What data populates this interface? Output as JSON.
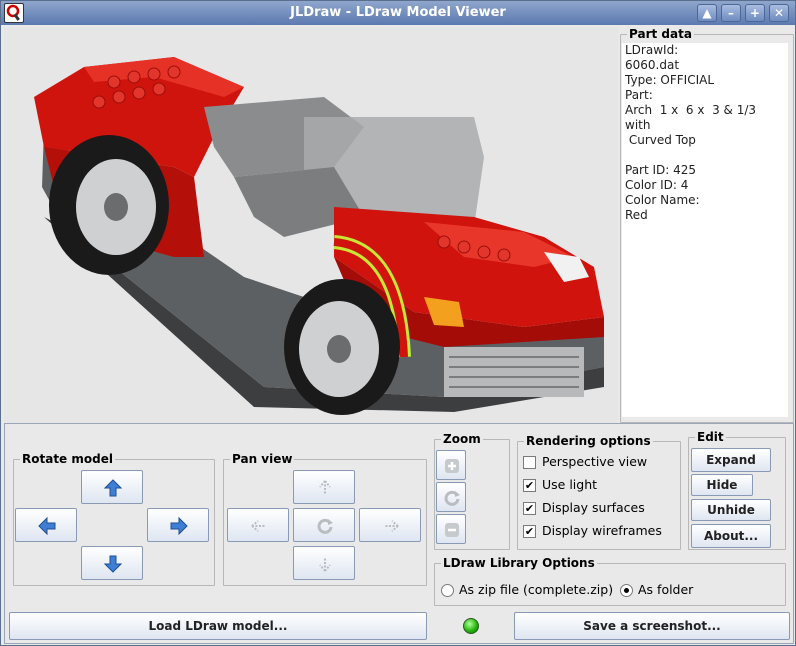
{
  "window": {
    "title": "JLDraw - LDraw Model Viewer",
    "controls": [
      "▲",
      "–",
      "+",
      "✕"
    ]
  },
  "part_data": {
    "legend": "Part data",
    "text": "LDrawId:\n6060.dat\nType: OFFICIAL\nPart:\nArch  1 x  6 x  3 & 1/3 with\n Curved Top\n\nPart ID: 425\nColor ID: 4\nColor Name:\nRed"
  },
  "rotate": {
    "legend": "Rotate model"
  },
  "pan": {
    "legend": "Pan view"
  },
  "zoom": {
    "legend": "Zoom"
  },
  "rendering": {
    "legend": "Rendering options",
    "options": [
      {
        "label": "Perspective view",
        "checked": false
      },
      {
        "label": "Use light",
        "checked": true
      },
      {
        "label": "Display surfaces",
        "checked": true
      },
      {
        "label": "Display wireframes",
        "checked": true
      }
    ]
  },
  "edit": {
    "legend": "Edit",
    "expand": "Expand",
    "hide": "Hide",
    "unhide": "Unhide",
    "about": "About..."
  },
  "library": {
    "legend": "LDraw Library Options",
    "zip": "As zip file (complete.zip)",
    "folder": "As folder",
    "selected": "folder"
  },
  "actions": {
    "load": "Load LDraw model...",
    "screenshot": "Save a screenshot..."
  },
  "status": {
    "led_color": "#27b712"
  },
  "model": {
    "color": "#d0130d",
    "highlight_color": "#c6ff3a"
  }
}
